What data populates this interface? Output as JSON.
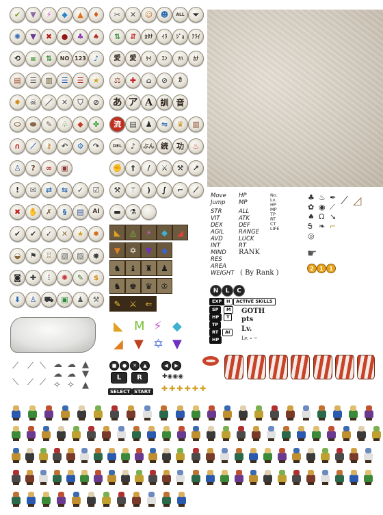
{
  "text_icons": {
    "no_label": "NO",
    "kana_1": "ｶﾀﾅ",
    "kana_2": "ｲﾗ",
    "kana_3": "ｼﾞｮ",
    "kana_4": "ﾃﾗｲ",
    "kanji_1": "愛",
    "kanji_2": "愛",
    "kana_5": "ｹｲ",
    "kana_6": "ｴﾝ",
    "kana_7": "ｿﾊ",
    "char_a": "あ",
    "char_katakana_a": "ア",
    "char_latin_a": "A",
    "kanji_kun": "訓",
    "kanji_on": "音",
    "kanji_ryu": "流",
    "kanji_zoku": "続",
    "kanji_kou": "功",
    "del_label": "DEL",
    "ai_label": "AI",
    "all_label": "ALL"
  },
  "stats_left": [
    "Move",
    "Jump",
    "STR",
    "VIT",
    "DEX",
    "AGIL",
    "AVD",
    "INT",
    "MIND",
    "RES",
    "AREA",
    "WEIGHT"
  ],
  "stats_mid": [
    "HP",
    "MP",
    "ALL",
    "ATK",
    "DEF",
    "RANGE",
    "LUCK",
    "RT",
    "RANK"
  ],
  "stats_small": [
    "No.",
    "Lv.",
    "HP",
    "MP",
    "TP",
    "RT",
    "CT",
    "LIFE"
  ],
  "by_rank": "( By Rank )",
  "badges": [
    "N",
    "L",
    "C"
  ],
  "coins": [
    "2",
    "1",
    "1"
  ],
  "skill_labels": {
    "exp": "EXP",
    "h": "H",
    "active_skills": "ACTIVE SKILLS",
    "sp": "SP",
    "m": "M",
    "hp": "HP",
    "t": "T",
    "tp": "TP",
    "rt": "RT",
    "ai": "AI",
    "hp2": "HP"
  },
  "goth_text": "GOTH",
  "pts_text": "pts",
  "lv_text": "Lv.",
  "lv_small": "Lv. ∘ ~",
  "controller": {
    "l": "L",
    "r": "R",
    "select": "SELECT",
    "start": "START"
  },
  "colors": {
    "parchment": "#d9d2c6",
    "drum_red": "#c9432b",
    "drum_white": "#f3ece6",
    "icon_face": "#e6e2d8",
    "coin": "#e8a41c"
  }
}
